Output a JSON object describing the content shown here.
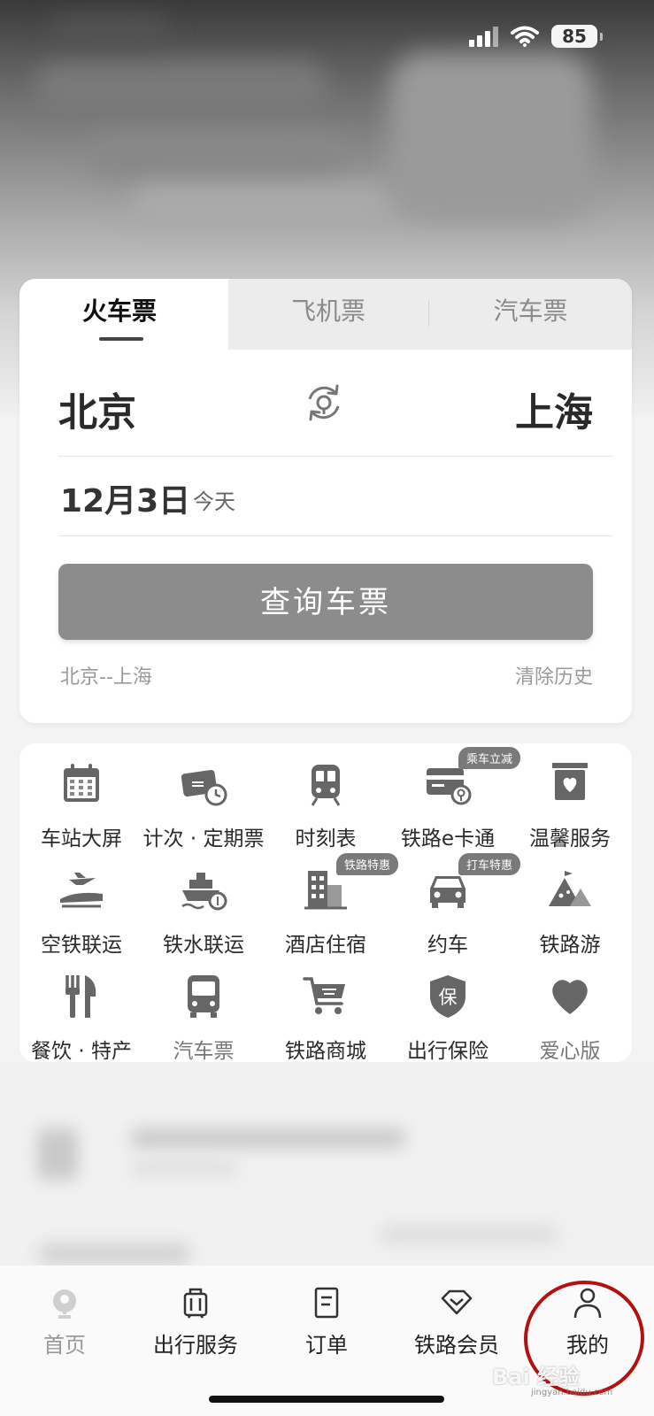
{
  "status": {
    "battery": "85"
  },
  "ticket_tabs": [
    {
      "label": "火车票",
      "active": true
    },
    {
      "label": "飞机票",
      "active": false
    },
    {
      "label": "汽车票",
      "active": false
    }
  ],
  "search": {
    "from_city": "北京",
    "to_city": "上海",
    "date": "12月3日",
    "date_hint": "今天",
    "button_label": "查询车票",
    "history_route": "北京--上海",
    "clear_history": "清除历史"
  },
  "services": [
    {
      "label": "车站大屏",
      "icon": "calendar-icon"
    },
    {
      "label": "计次 · 定期票",
      "icon": "ticket-clock-icon"
    },
    {
      "label": "时刻表",
      "icon": "train-icon"
    },
    {
      "label": "铁路e卡通",
      "icon": "rail-card-icon",
      "badge": "乘车立减"
    },
    {
      "label": "温馨服务",
      "icon": "heart-box-icon"
    },
    {
      "label": "空铁联运",
      "icon": "plane-train-icon"
    },
    {
      "label": "铁水联运",
      "icon": "ship-icon"
    },
    {
      "label": "酒店住宿",
      "icon": "hotel-icon",
      "badge": "铁路特惠"
    },
    {
      "label": "约车",
      "icon": "car-icon",
      "badge": "打车特惠"
    },
    {
      "label": "铁路游",
      "icon": "mountain-icon"
    },
    {
      "label": "餐饮 · 特产",
      "icon": "fork-knife-icon"
    },
    {
      "label": "汽车票",
      "icon": "bus-icon"
    },
    {
      "label": "铁路商城",
      "icon": "cart-icon"
    },
    {
      "label": "出行保险",
      "icon": "insurance-shield-icon"
    },
    {
      "label": "爱心版",
      "icon": "heart-icon"
    }
  ],
  "nav": [
    {
      "label": "首页",
      "icon": "rail-logo-icon"
    },
    {
      "label": "出行服务",
      "icon": "luggage-icon"
    },
    {
      "label": "订单",
      "icon": "order-icon"
    },
    {
      "label": "铁路会员",
      "icon": "diamond-icon"
    },
    {
      "label": "我的",
      "icon": "user-icon"
    }
  ],
  "watermark": {
    "text": "Bai 经验",
    "sub": "jingyan.baidu.com"
  },
  "colors": {
    "highlight_circle": "#b51010",
    "button": "#8c8c8c"
  }
}
